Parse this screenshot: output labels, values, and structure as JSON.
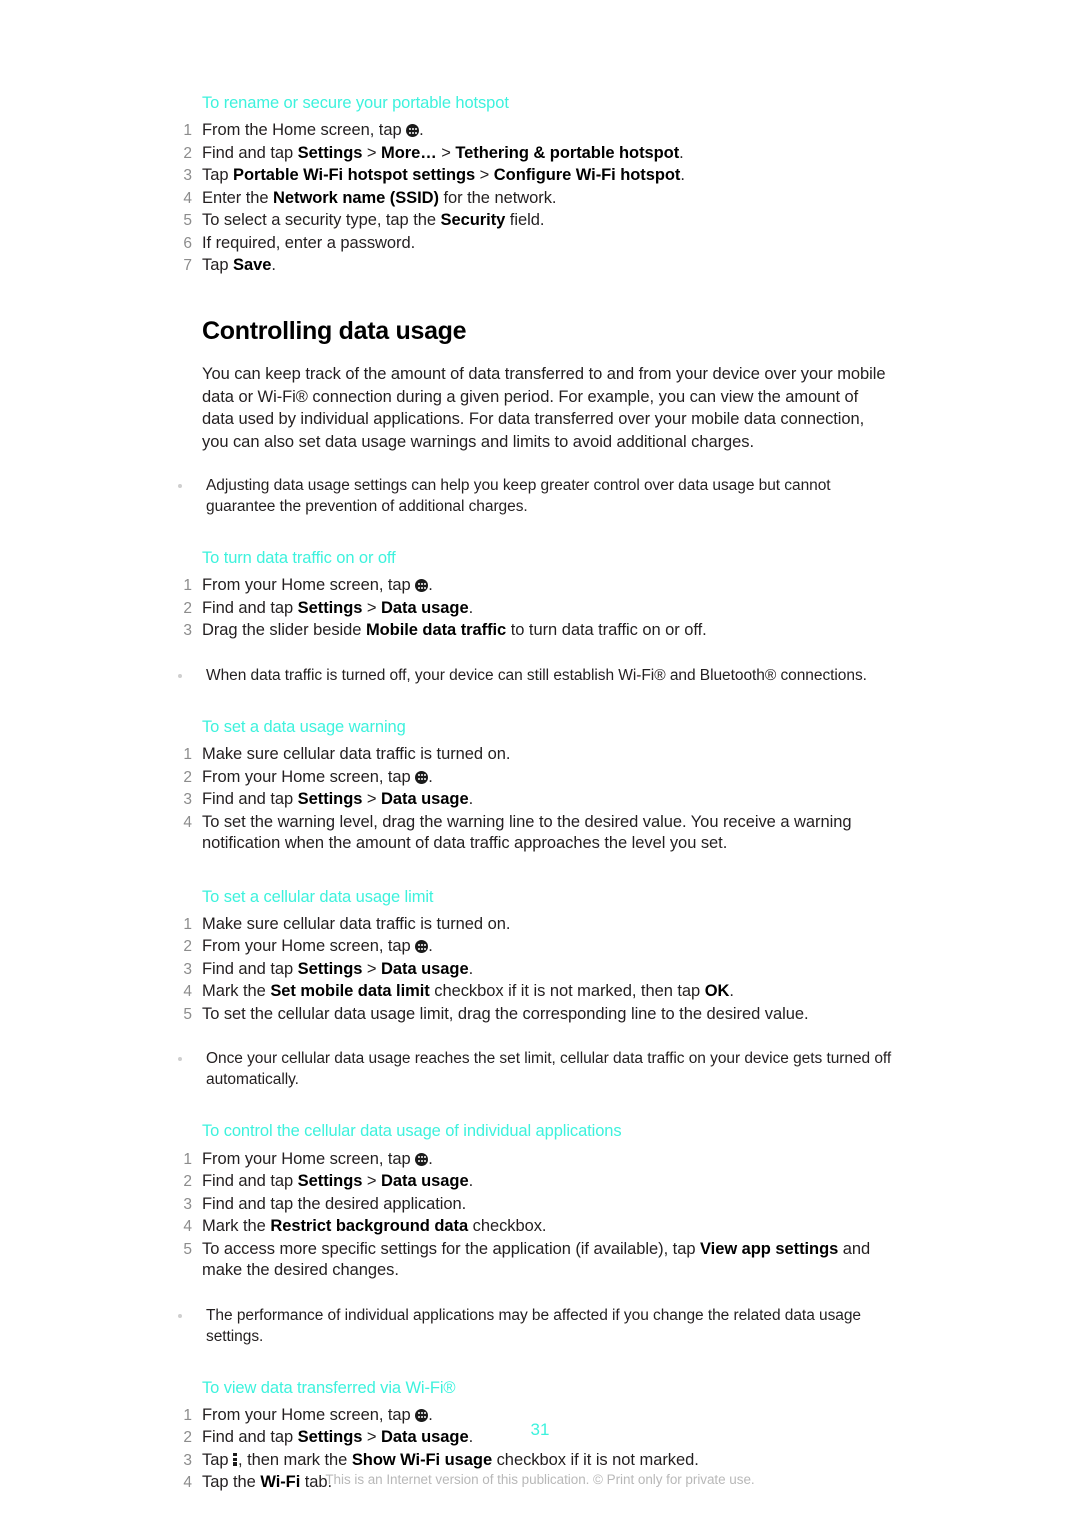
{
  "theme": {
    "accent": "#3df2dd",
    "body_text": "#231f20",
    "step_number": "#8c8c8c",
    "footer_text": "#b8b8b8",
    "background": "#ffffff"
  },
  "icons": {
    "app_drawer": "app-drawer-icon",
    "overflow_menu": "overflow-menu-icon"
  },
  "sections": {
    "hotspot": {
      "heading": "To rename or secure your portable hotspot",
      "steps": {
        "s1_a": "From the Home screen, tap ",
        "s1_b": ".",
        "s2_a": "Find and tap ",
        "s2_b": "Settings",
        "s2_c": " > ",
        "s2_d": "More…",
        "s2_e": " > ",
        "s2_f": "Tethering & portable hotspot",
        "s2_g": ".",
        "s3_a": "Tap ",
        "s3_b": "Portable Wi-Fi hotspot settings",
        "s3_c": " > ",
        "s3_d": "Configure Wi-Fi hotspot",
        "s3_e": ".",
        "s4_a": "Enter the ",
        "s4_b": "Network name (SSID)",
        "s4_c": " for the network.",
        "s5_a": "To select a security type, tap the ",
        "s5_b": "Security",
        "s5_c": " field.",
        "s6": "If required, enter a password.",
        "s7_a": "Tap ",
        "s7_b": "Save",
        "s7_c": "."
      }
    },
    "controlling_data_usage": {
      "title": "Controlling data usage",
      "intro": "You can keep track of the amount of data transferred to and from your device over your mobile data or Wi-Fi® connection during a given period. For example, you can view the amount of data used by individual applications. For data transferred over your mobile data connection, you can also set data usage warnings and limits to avoid additional charges.",
      "note": "Adjusting data usage settings can help you keep greater control over data usage but cannot guarantee the prevention of additional charges."
    },
    "turn_data_traffic": {
      "heading": "To turn data traffic on or off",
      "steps": {
        "s1_a": "From your Home screen, tap ",
        "s1_b": ".",
        "s2_a": "Find and tap ",
        "s2_b": "Settings",
        "s2_c": " > ",
        "s2_d": "Data usage",
        "s2_e": ".",
        "s3_a": "Drag the slider beside ",
        "s3_b": "Mobile data traffic",
        "s3_c": " to turn data traffic on or off."
      },
      "note": "When data traffic is turned off, your device can still establish Wi-Fi® and Bluetooth® connections."
    },
    "data_usage_warning": {
      "heading": "To set a data usage warning",
      "steps": {
        "s1": "Make sure cellular data traffic is turned on.",
        "s2_a": "From your Home screen, tap ",
        "s2_b": ".",
        "s3_a": "Find and tap ",
        "s3_b": "Settings",
        "s3_c": " > ",
        "s3_d": "Data usage",
        "s3_e": ".",
        "s4": "To set the warning level, drag the warning line to the desired value. You receive a warning notification when the amount of data traffic approaches the level you set."
      }
    },
    "cellular_data_limit": {
      "heading": "To set a cellular data usage limit",
      "steps": {
        "s1": "Make sure cellular data traffic is turned on.",
        "s2_a": "From your Home screen, tap ",
        "s2_b": ".",
        "s3_a": "Find and tap ",
        "s3_b": "Settings",
        "s3_c": " > ",
        "s3_d": "Data usage",
        "s3_e": ".",
        "s4_a": "Mark the ",
        "s4_b": "Set mobile data limit",
        "s4_c": " checkbox if it is not marked, then tap ",
        "s4_d": "OK",
        "s4_e": ".",
        "s5": "To set the cellular data usage limit, drag the corresponding line to the desired value."
      },
      "note": "Once your cellular data usage reaches the set limit, cellular data traffic on your device gets turned off automatically."
    },
    "individual_applications": {
      "heading": "To control the cellular data usage of individual applications",
      "steps": {
        "s1_a": "From your Home screen, tap ",
        "s1_b": ".",
        "s2_a": "Find and tap ",
        "s2_b": "Settings",
        "s2_c": " > ",
        "s2_d": "Data usage",
        "s2_e": ".",
        "s3": "Find and tap the desired application.",
        "s4_a": "Mark the ",
        "s4_b": "Restrict background data",
        "s4_c": " checkbox.",
        "s5_a": "To access more specific settings for the application (if available), tap ",
        "s5_b": "View app settings",
        "s5_c": " and make the desired changes."
      },
      "note": "The performance of individual applications may be affected if you change the related data usage settings."
    },
    "view_wifi_data": {
      "heading": "To view data transferred via Wi-Fi®",
      "steps": {
        "s1_a": "From your Home screen, tap ",
        "s1_b": ".",
        "s2_a": "Find and tap ",
        "s2_b": "Settings",
        "s2_c": " > ",
        "s2_d": "Data usage",
        "s2_e": ".",
        "s3_a": "Tap ",
        "s3_b": ", then mark the ",
        "s3_c": "Show Wi-Fi usage",
        "s3_d": " checkbox if it is not marked.",
        "s4_a": "Tap the ",
        "s4_b": "Wi-Fi",
        "s4_c": " tab."
      }
    }
  },
  "page_number": "31",
  "footer": "This is an Internet version of this publication. © Print only for private use."
}
